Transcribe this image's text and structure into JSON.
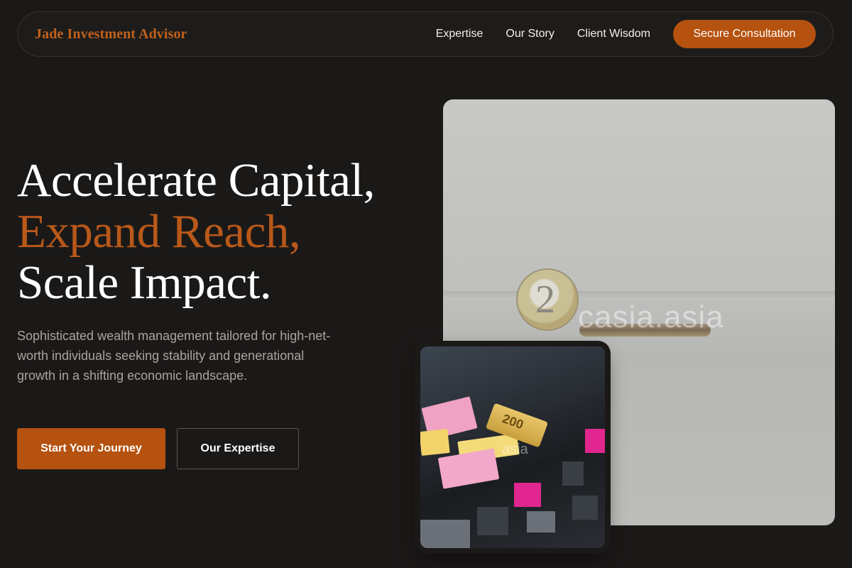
{
  "nav": {
    "brand": "Jade Investment Advisor",
    "links": [
      "Expertise",
      "Our Story",
      "Client Wisdom"
    ],
    "cta": "Secure Consultation"
  },
  "hero": {
    "headline_line1": "Accelerate Capital,",
    "headline_line2": "Expand Reach,",
    "headline_line3": "Scale Impact.",
    "subtitle": "Sophisticated wealth management tailored for high-net-worth individuals seeking stability and generational growth in a shifting economic landscape.",
    "primary_button": "Start Your Journey",
    "secondary_button": "Our Expertise"
  },
  "images": {
    "main_watermark": "casia.asia",
    "coin_numeral": "2",
    "small_watermark": "asia",
    "bill_numeral": "200"
  },
  "colors": {
    "accent": "#b5520f",
    "background": "#1b1918",
    "brand": "#c0611c"
  }
}
